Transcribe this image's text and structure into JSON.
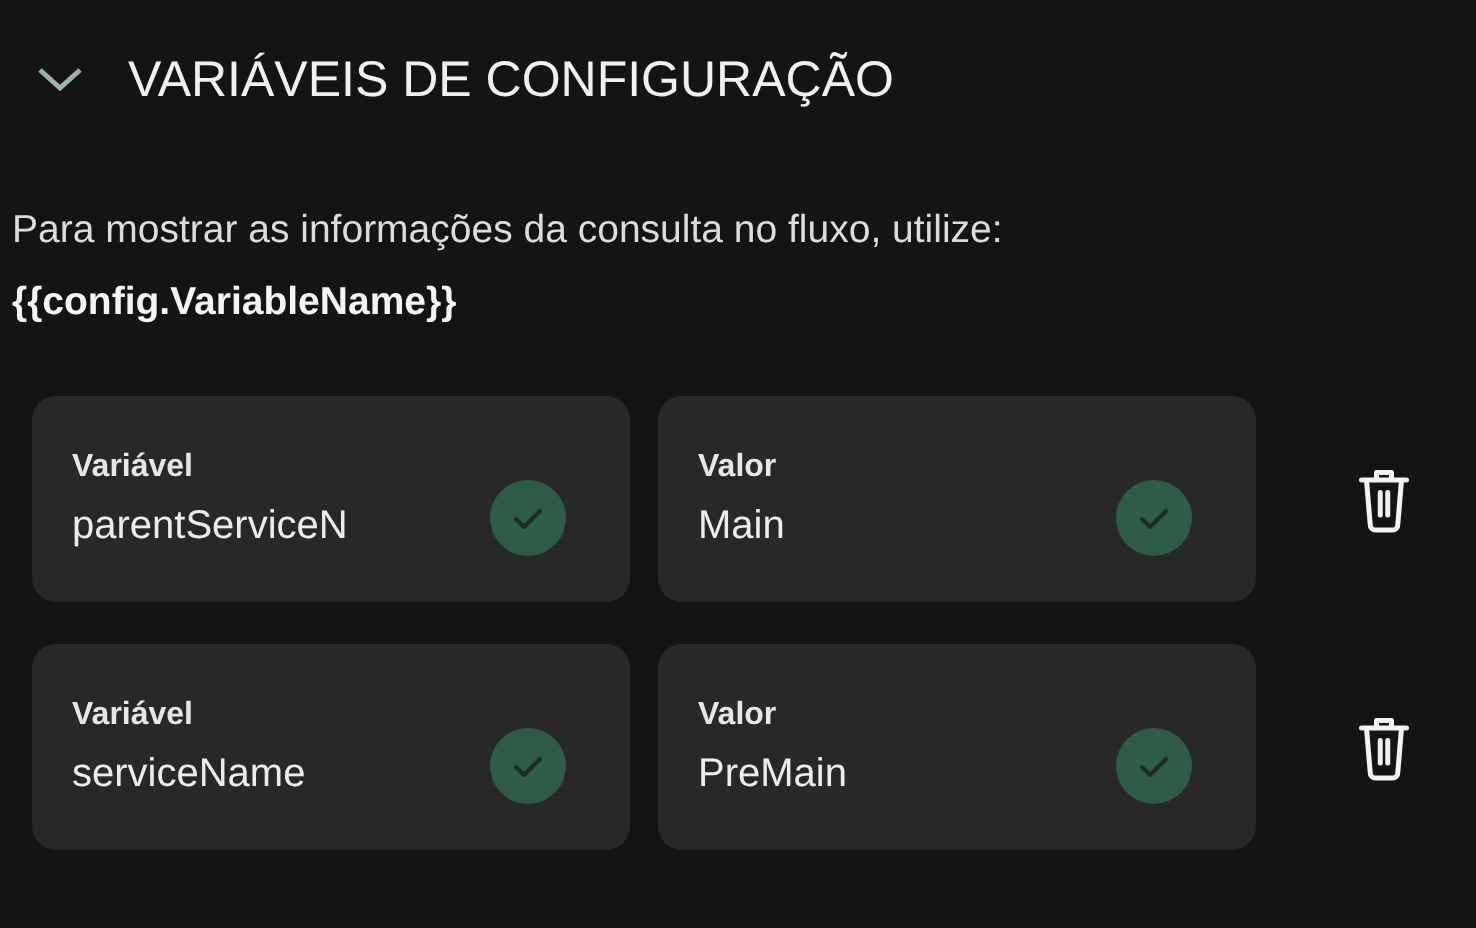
{
  "section": {
    "title": "VARIÁVEIS DE CONFIGURAÇÃO",
    "expanded": true
  },
  "description": "Para mostrar as informações da consulta no fluxo, utilize:",
  "syntax": "{{config.VariableName}}",
  "variables": [
    {
      "name": {
        "label": "Variável",
        "value": "parentServiceN",
        "valid": true
      },
      "value": {
        "label": "Valor",
        "value": "Main",
        "valid": true
      }
    },
    {
      "name": {
        "label": "Variável",
        "value": "serviceName",
        "valid": true
      },
      "value": {
        "label": "Valor",
        "value": "PreMain",
        "valid": true
      }
    }
  ]
}
